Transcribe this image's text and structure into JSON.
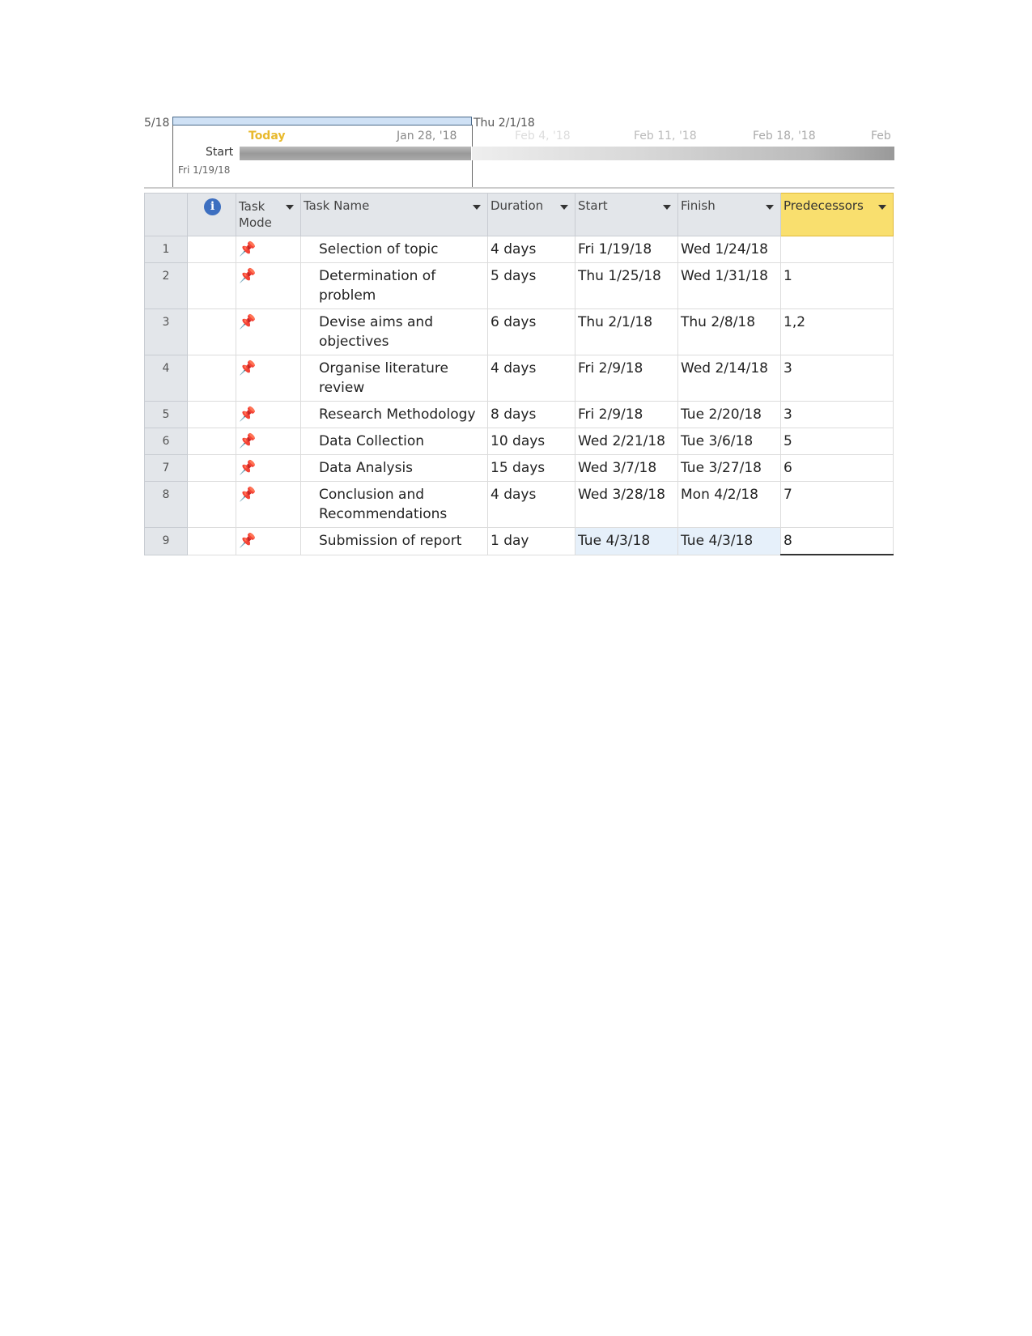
{
  "timeline": {
    "left_date_fragment": "5/18",
    "current_end": "Thu 2/1/18",
    "today_label": "Today",
    "ticks": [
      "Jan 28, '18",
      "Feb 4, '18",
      "Feb 11, '18",
      "Feb 18, '18",
      "Feb"
    ],
    "start_label": "Start",
    "start_date": "Fri 1/19/18",
    "colors": {
      "today": "#e8b92c",
      "bar": "#9a9a9a",
      "range": "#cfe1f5"
    }
  },
  "table": {
    "headers": {
      "info": "i",
      "mode": "Task Mode",
      "name": "Task Name",
      "duration": "Duration",
      "start": "Start",
      "finish": "Finish",
      "predecessors": "Predecessors"
    },
    "rows": [
      {
        "id": "1",
        "name": "Selection of topic",
        "duration": "4 days",
        "start": "Fri 1/19/18",
        "finish": "Wed 1/24/18",
        "pred": ""
      },
      {
        "id": "2",
        "name": "Determination of problem",
        "duration": "5 days",
        "start": "Thu 1/25/18",
        "finish": "Wed 1/31/18",
        "pred": "1"
      },
      {
        "id": "3",
        "name": "Devise aims and objectives",
        "duration": "6 days",
        "start": "Thu 2/1/18",
        "finish": "Thu 2/8/18",
        "pred": "1,2"
      },
      {
        "id": "4",
        "name": "Organise literature review",
        "duration": "4 days",
        "start": "Fri 2/9/18",
        "finish": "Wed 2/14/18",
        "pred": "3"
      },
      {
        "id": "5",
        "name": "Research Methodology",
        "duration": "8 days",
        "start": "Fri 2/9/18",
        "finish": "Tue 2/20/18",
        "pred": "3"
      },
      {
        "id": "6",
        "name": "Data Collection",
        "duration": "10 days",
        "start": "Wed 2/21/18",
        "finish": "Tue 3/6/18",
        "pred": "5"
      },
      {
        "id": "7",
        "name": "Data Analysis",
        "duration": "15 days",
        "start": "Wed 3/7/18",
        "finish": "Tue 3/27/18",
        "pred": "6"
      },
      {
        "id": "8",
        "name": "Conclusion and Recommendations",
        "duration": "4 days",
        "start": "Wed 3/28/18",
        "finish": "Mon 4/2/18",
        "pred": "7"
      },
      {
        "id": "9",
        "name": "Submission of report",
        "duration": "1 day",
        "start": "Tue 4/3/18",
        "finish": "Tue 4/3/18",
        "pred": "8"
      }
    ],
    "mode_icon": "pushpin-icon"
  }
}
